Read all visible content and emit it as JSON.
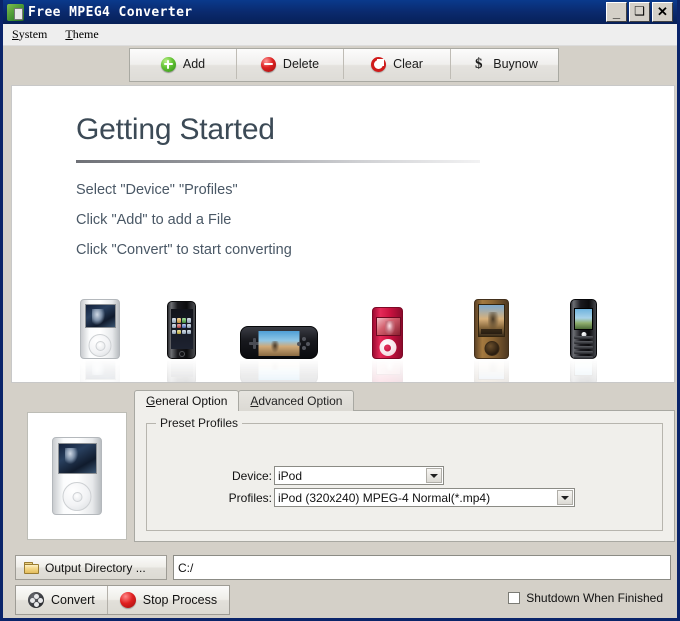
{
  "window": {
    "title": "Free MPEG4 Converter",
    "app_icon": "app-icon",
    "minimize_label": "_",
    "maximize_label": "❑",
    "close_label": "✕"
  },
  "menubar": {
    "items": [
      {
        "label": "System",
        "accel": "S"
      },
      {
        "label": "Theme",
        "accel": "T"
      }
    ]
  },
  "toolbar": {
    "buttons": [
      {
        "label": "Add",
        "icon": "add-circle-icon"
      },
      {
        "label": "Delete",
        "icon": "delete-circle-icon"
      },
      {
        "label": "Clear",
        "icon": "clear-circle-icon"
      },
      {
        "label": "Buynow",
        "icon": "dollar-icon"
      }
    ]
  },
  "getting_started": {
    "title": "Getting Started",
    "steps": [
      "Select \"Device\" \"Profiles\"",
      "Click  \"Add\" to add a File",
      "Click  \"Convert\" to start converting"
    ],
    "devices": [
      {
        "name": "ipod-classic"
      },
      {
        "name": "iphone"
      },
      {
        "name": "psp"
      },
      {
        "name": "ipod-nano-red"
      },
      {
        "name": "zune"
      },
      {
        "name": "blackberry-pearl"
      }
    ]
  },
  "tabs": [
    {
      "label": "General Option",
      "accel": "G",
      "active": true
    },
    {
      "label": "Advanced Option",
      "accel": "A",
      "active": false
    }
  ],
  "preset_profiles": {
    "group_title": "Preset Profiles",
    "device_label": "Device:",
    "device_value": "iPod",
    "profiles_label": "Profiles:",
    "profiles_value": "iPod (320x240) MPEG-4 Normal(*.mp4)"
  },
  "preview": {
    "name": "ipod-classic-preview"
  },
  "output": {
    "button_label": "Output Directory ...",
    "path_value": "C:/",
    "folder_icon": "folder-icon"
  },
  "actions": {
    "convert_label": "Convert",
    "stop_label": "Stop Process",
    "shutdown_label": "Shutdown When Finished",
    "shutdown_checked": false
  },
  "colors": {
    "titlebar": "#0a2a6e",
    "chrome": "#d4d0c8",
    "panel": "#f0efeb",
    "heading": "#3c4a56",
    "body_text": "#4a5866",
    "accent_green": "#62c233",
    "accent_red": "#dd2222"
  }
}
